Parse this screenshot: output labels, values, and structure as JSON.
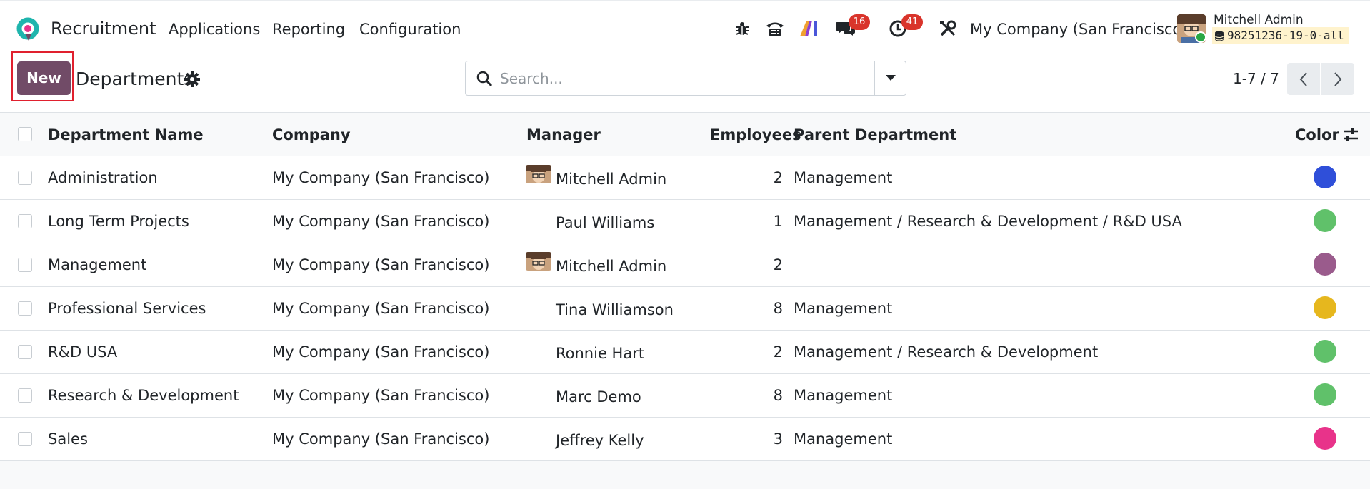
{
  "navbar": {
    "app_name": "Recruitment",
    "menu": [
      "Applications",
      "Reporting",
      "Configuration"
    ],
    "messages_badge": "16",
    "activities_badge": "41",
    "company": "My Company (San Francisco)",
    "user_name": "Mitchell Admin",
    "database": "98251236-19-0-all"
  },
  "control": {
    "new_label": "New",
    "breadcrumb": "Departments",
    "search_placeholder": "Search...",
    "pager": "1-7 / 7"
  },
  "table": {
    "headers": {
      "name": "Department Name",
      "company": "Company",
      "manager": "Manager",
      "employees": "Employees",
      "parent": "Parent Department",
      "color": "Color"
    },
    "rows": [
      {
        "name": "Administration",
        "company": "My Company (San Francisco)",
        "manager": "Mitchell Admin",
        "manager_avatar": true,
        "employees": "2",
        "parent": "Management",
        "color": "#2f4fd9"
      },
      {
        "name": "Long Term Projects",
        "company": "My Company (San Francisco)",
        "manager": "Paul Williams",
        "manager_avatar": false,
        "employees": "1",
        "parent": "Management / Research & Development / R&D USA",
        "color": "#60c16a"
      },
      {
        "name": "Management",
        "company": "My Company (San Francisco)",
        "manager": "Mitchell Admin",
        "manager_avatar": true,
        "employees": "2",
        "parent": "",
        "color": "#9a5b8c"
      },
      {
        "name": "Professional Services",
        "company": "My Company (San Francisco)",
        "manager": "Tina Williamson",
        "manager_avatar": false,
        "employees": "8",
        "parent": "Management",
        "color": "#e6b71e"
      },
      {
        "name": "R&D USA",
        "company": "My Company (San Francisco)",
        "manager": "Ronnie Hart",
        "manager_avatar": false,
        "employees": "2",
        "parent": "Management / Research & Development",
        "color": "#60c16a"
      },
      {
        "name": "Research & Development",
        "company": "My Company (San Francisco)",
        "manager": "Marc Demo",
        "manager_avatar": false,
        "employees": "8",
        "parent": "Management",
        "color": "#60c16a"
      },
      {
        "name": "Sales",
        "company": "My Company (San Francisco)",
        "manager": "Jeffrey Kelly",
        "manager_avatar": false,
        "employees": "3",
        "parent": "Management",
        "color": "#e8338a"
      }
    ]
  },
  "icons": {
    "logo": "odoo-logo-icon",
    "debug": "bug-icon",
    "phone": "phone-icon",
    "ai": "ai-icon",
    "messages": "chat-icon",
    "activities": "clock-icon",
    "tools": "tools-icon",
    "gear": "gear-icon",
    "search": "search-icon",
    "dropdown": "caret-down-icon",
    "prev": "chevron-left-icon",
    "next": "chevron-right-icon",
    "optional_columns": "sliders-icon",
    "database": "database-icon"
  }
}
